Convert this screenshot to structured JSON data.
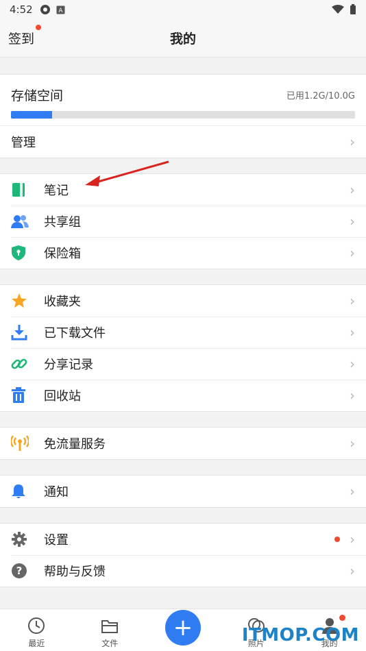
{
  "status_bar": {
    "time": "4:52"
  },
  "header": {
    "checkin_label": "签到",
    "title": "我的"
  },
  "storage": {
    "label": "存储空间",
    "used_text": "已用1.2G/10.0G",
    "used_gb": 1.2,
    "total_gb": 10.0
  },
  "manage": {
    "label": "管理"
  },
  "group1": [
    {
      "label": "笔记",
      "icon": "notebook-icon"
    },
    {
      "label": "共享组",
      "icon": "people-icon"
    },
    {
      "label": "保险箱",
      "icon": "shield-lock-icon"
    }
  ],
  "group2": [
    {
      "label": "收藏夹",
      "icon": "star-icon"
    },
    {
      "label": "已下载文件",
      "icon": "download-icon"
    },
    {
      "label": "分享记录",
      "icon": "link-icon"
    },
    {
      "label": "回收站",
      "icon": "trash-icon"
    }
  ],
  "group3": [
    {
      "label": "免流量服务",
      "icon": "antenna-icon"
    }
  ],
  "group4": [
    {
      "label": "通知",
      "icon": "bell-icon"
    }
  ],
  "group5": [
    {
      "label": "设置",
      "icon": "gear-icon"
    },
    {
      "label": "帮助与反馈",
      "icon": "help-icon"
    }
  ],
  "tabs": {
    "recent": "最近",
    "files": "文件",
    "photos": "照片",
    "mine": "我的"
  },
  "watermark": "ITMOP.COM",
  "colors": {
    "accent": "#2f7cf3",
    "badge": "#f34a2d"
  }
}
